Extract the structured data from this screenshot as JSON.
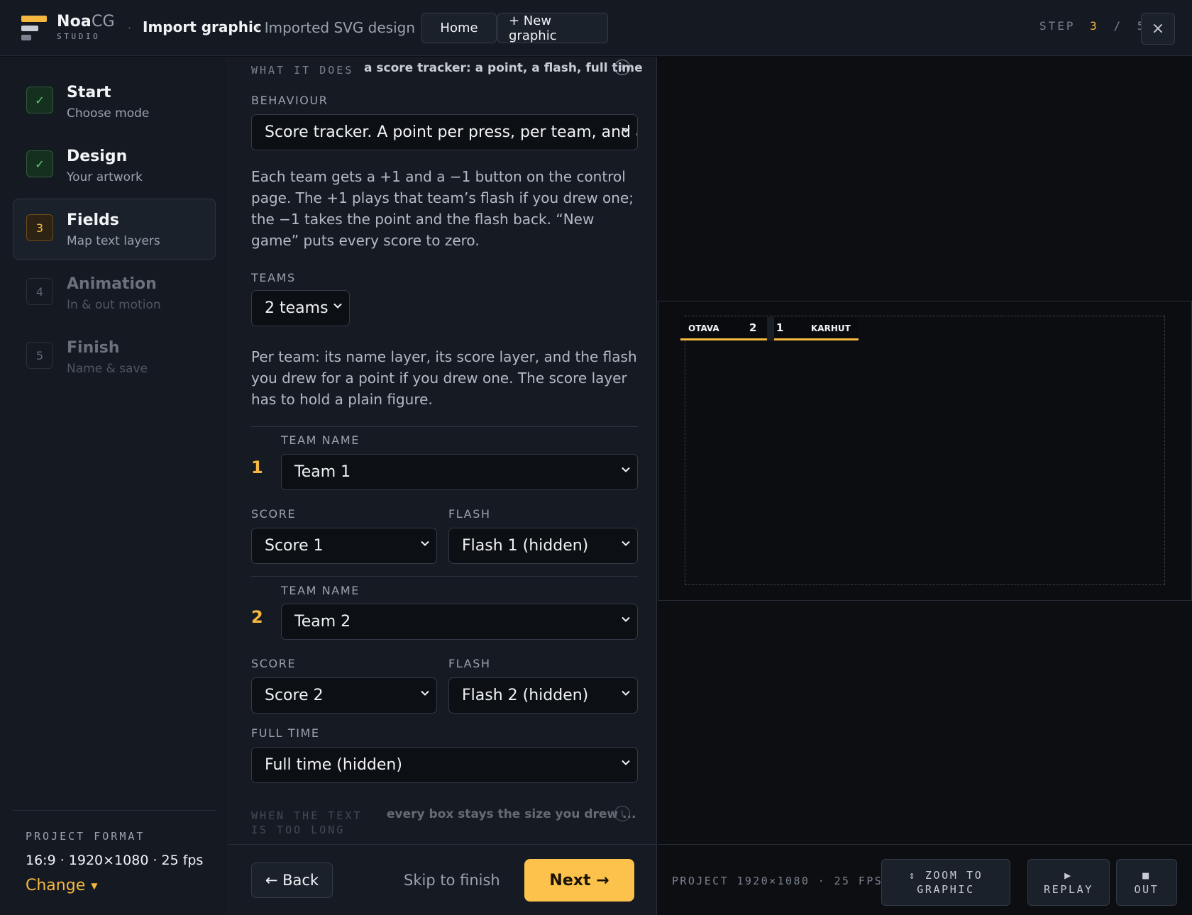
{
  "header": {
    "brand_bold": "Noa",
    "brand_light": "CG",
    "brand_sub": "STUDIO",
    "separator": "·",
    "title": "Import graphic",
    "subtitle": "· Imported SVG design",
    "home_label": "Home",
    "new_graphic_label": "+ New graphic",
    "step_label": "STEP",
    "step_current": "3",
    "step_sep": "/",
    "step_total": "5",
    "close_icon": "×"
  },
  "sidebar": {
    "items": [
      {
        "badge": "✓",
        "title": "Start",
        "subtitle": "Choose mode",
        "state": "done"
      },
      {
        "badge": "✓",
        "title": "Design",
        "subtitle": "Your artwork",
        "state": "done"
      },
      {
        "badge": "3",
        "title": "Fields",
        "subtitle": "Map text layers",
        "state": "current"
      },
      {
        "badge": "4",
        "title": "Animation",
        "subtitle": "In & out motion",
        "state": "todo"
      },
      {
        "badge": "5",
        "title": "Finish",
        "subtitle": "Name & save",
        "state": "todo"
      }
    ],
    "project_format_label": "PROJECT FORMAT",
    "project_format_value": "16:9 · 1920×1080 · 25 fps",
    "change_label": "Change",
    "change_caret": "▼"
  },
  "form": {
    "what_label": "WHAT IT DOES",
    "what_value": "a score tracker: a point, a flash, full time",
    "info_icon": "i",
    "behaviour_label": "BEHAVIOUR",
    "behaviour_value": "Score tracker. A point per press, per team, and a m",
    "behaviour_desc": "Each team gets a +1 and a −1 button on the control page. The +1 plays that team’s flash if you drew one; the −1 takes the point and the flash back. “New game” puts every score to zero.",
    "teams_label": "TEAMS",
    "teams_value": "2 teams",
    "per_team_desc": "Per team: its name layer, its score layer, and the flash you drew for a point if you drew one. The score layer has to hold a plain figure.",
    "teams": [
      {
        "num": "1",
        "name_label": "TEAM NAME",
        "name_value": "Team 1",
        "score_label": "SCORE",
        "score_value": "Score 1",
        "flash_label": "FLASH",
        "flash_value": "Flash 1 (hidden)"
      },
      {
        "num": "2",
        "name_label": "TEAM NAME",
        "name_value": "Team 2",
        "score_label": "SCORE",
        "score_value": "Score 2",
        "flash_label": "FLASH",
        "flash_value": "Flash 2 (hidden)"
      }
    ],
    "full_time_label": "FULL TIME",
    "full_time_value": "Full time (hidden)",
    "overflow_label_1": "WHEN THE TEXT",
    "overflow_label_2": "IS TOO LONG",
    "overflow_value": "every box stays the size you drew ..."
  },
  "footer": {
    "back_label": "← Back",
    "skip_label": "Skip to finish",
    "next_label": "Next →"
  },
  "preview": {
    "scorebug": {
      "team1": "OTAVA",
      "score1": "2",
      "score2": "1",
      "team2": "KARHUT"
    },
    "project_info": "PROJECT 1920×1080 · 25 FPS",
    "zoom_icon": "⇕",
    "zoom_label_1": "ZOOM TO",
    "zoom_label_2": "GRAPHIC",
    "replay_icon": "▶",
    "replay_label": "REPLAY",
    "out_icon": "■",
    "out_label": "OUT"
  },
  "colors": {
    "accent": "#f5b740",
    "done": "#5fce7a",
    "next_button": "#fcc24c"
  }
}
